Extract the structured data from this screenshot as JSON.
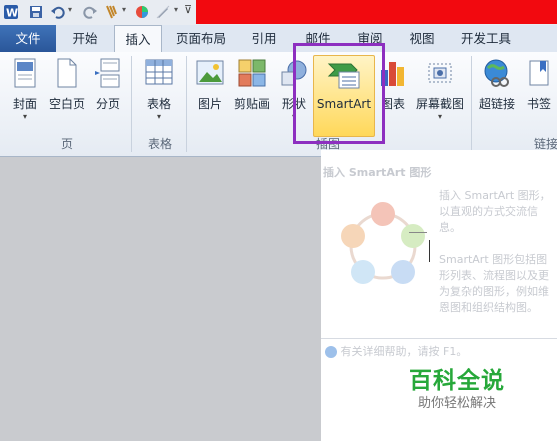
{
  "tabs": [
    "文件",
    "开始",
    "插入",
    "页面布局",
    "引用",
    "邮件",
    "审阅",
    "视图",
    "开发工具"
  ],
  "ribbon": {
    "cover": "封面",
    "blank_page": "空白页",
    "page_break": "分页",
    "table": "表格",
    "picture": "图片",
    "clipart": "剪贴画",
    "shapes": "形状",
    "smartart": "SmartArt",
    "chart": "图表",
    "screenshot": "屏幕截图",
    "hyperlink": "超链接",
    "bookmark": "书签",
    "groups": {
      "pages": "页",
      "tables": "表格",
      "illustrations": "插图",
      "links": "链接"
    }
  },
  "tooltip": {
    "title": "插入 SmartArt 图形",
    "line1": "插入 SmartArt 图形，",
    "line2": "以直观的方式交流信",
    "line3": "息。",
    "line4": "SmartArt 图形包括图",
    "line5": "形列表、流程图以及更",
    "line6": "为复杂的图形，例如维",
    "line7": "恩图和组织结构图。",
    "help": "有关详细帮助，请按 F1。"
  },
  "watermark": {
    "title": "百科全说",
    "subtitle": "助你轻松解决"
  },
  "colors": {
    "file_tab": "#2a5699",
    "highlight": "#8d2fc0",
    "banner": "#f2090f",
    "brand": "#27a83a"
  }
}
